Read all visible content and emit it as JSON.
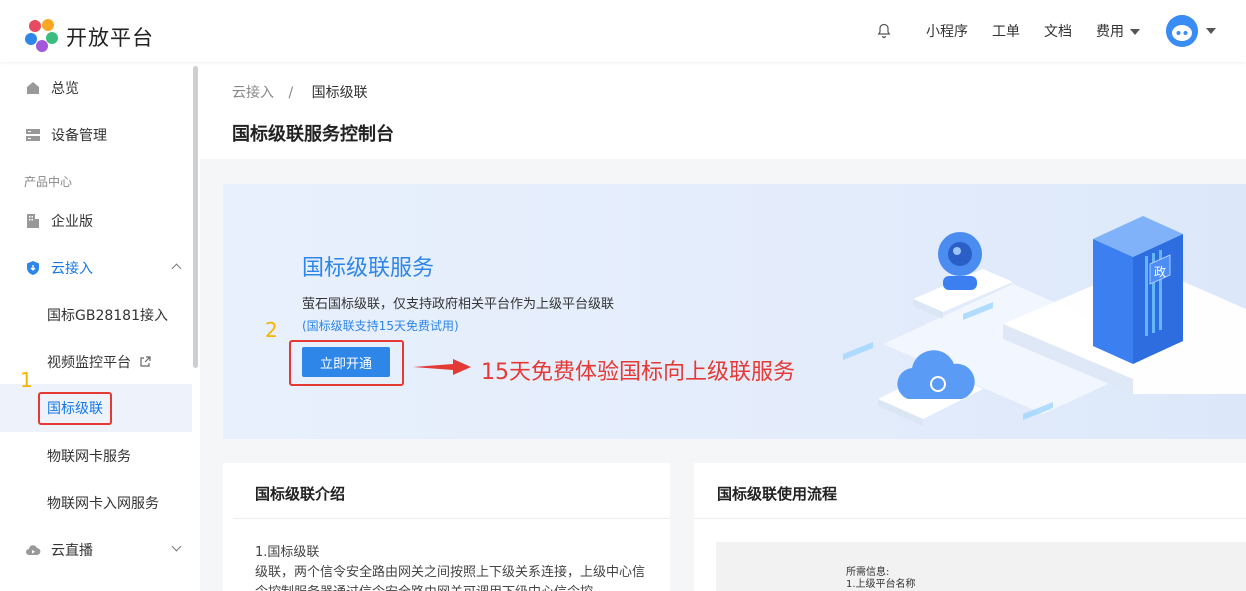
{
  "header": {
    "logo_text": "开放平台",
    "nav": [
      "小程序",
      "工单",
      "文档",
      "费用"
    ]
  },
  "sidebar": {
    "items": [
      {
        "label": "总览",
        "icon": "home-icon"
      },
      {
        "label": "设备管理",
        "icon": "device-icon"
      }
    ],
    "group_label": "产品中心",
    "enterprise": {
      "label": "企业版",
      "icon": "building-icon"
    },
    "cloud_access": {
      "label": "云接入",
      "icon": "cloud-access-icon"
    },
    "sub_items": [
      "国标GB28181接入",
      "视频监控平台",
      "国标级联",
      "物联网卡服务",
      "物联网卡入网服务"
    ],
    "cloud_live": {
      "label": "云直播",
      "icon": "cloud-live-icon"
    }
  },
  "breadcrumb": {
    "parent": "云接入",
    "separator": "/",
    "current": "国标级联"
  },
  "page_title": "国标级联服务控制台",
  "banner": {
    "title": "国标级联服务",
    "desc": "萤石国标级联，仅支持政府相关平台作为上级平台级联",
    "note": "(国标级联支持15天免费试用)",
    "button": "立即开通",
    "server_label": "政"
  },
  "annotations": {
    "num1": "1",
    "num2": "2",
    "promo": "15天免费体验国标向上级联服务"
  },
  "intro_card": {
    "title": "国标级联介绍",
    "subtitle": "1.国标级联",
    "body": "级联，两个信令安全路由网关之间按照上下级关系连接，上级中心信令控制服务器通过信令安全路由网关可调用下级中心信令控"
  },
  "flow_card": {
    "title": "国标级联使用流程",
    "line1": "所需信息:",
    "line2": "1.上级平台名称"
  },
  "colors": {
    "primary": "#2d86e8",
    "annotation_red": "#e53935",
    "annotation_yellow": "#f5b400"
  }
}
